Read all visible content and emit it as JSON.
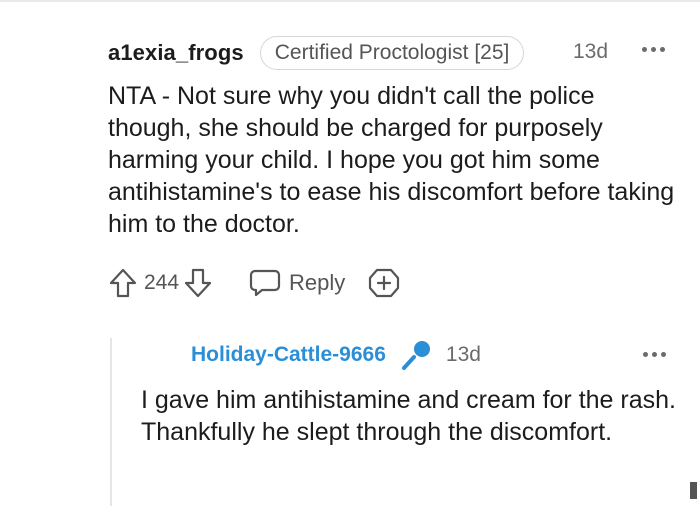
{
  "comment": {
    "username": "a1exia_frogs",
    "flair": "Certified Proctologist [25]",
    "timestamp": "13d",
    "body": "NTA - Not sure why you didn't call the police though, she should be charged for purposely harming your child. I hope you got him some antihistamine's to ease his discomfort before taking him to the doctor.",
    "votes": "244",
    "reply_label": "Reply",
    "icons": [
      "upvote-icon",
      "downvote-icon",
      "reply-icon",
      "award-icon",
      "more-options-icon"
    ]
  },
  "reply": {
    "username": "Holiday-Cattle-9666",
    "timestamp": "13d",
    "body": "I gave him antihistamine and cream for the rash. Thankfully he slept through the discomfort.",
    "icons": [
      "op-microphone-icon",
      "more-options-icon"
    ]
  },
  "colors": {
    "op_username": "#2b8fd8",
    "text": "#1c1c1c",
    "muted": "#6b6b6b"
  }
}
